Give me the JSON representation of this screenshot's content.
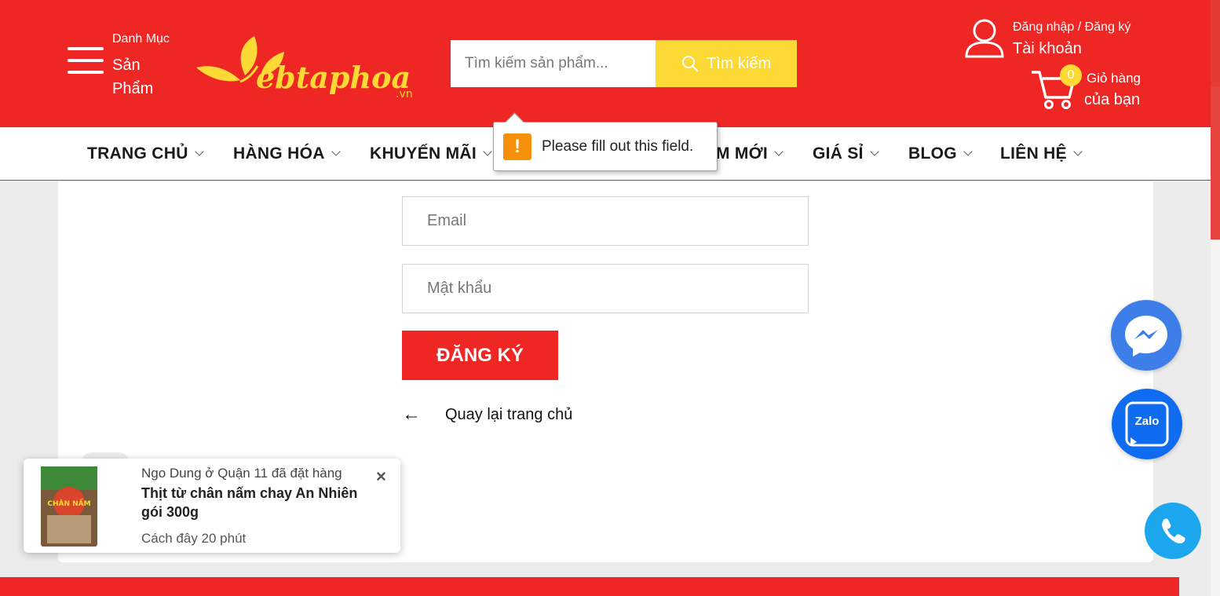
{
  "header": {
    "category_small": "Danh Mục",
    "category_line1": "Sản",
    "category_line2": "Phẩm",
    "logo_text": "ebtaphoa",
    "logo_suffix": ".vn",
    "search_placeholder": "Tìm kiếm sản phẩm...",
    "search_button": "Tìm kiếm",
    "account_line1": "Đăng nhập / Đăng ký",
    "account_line2": "Tài khoản",
    "cart_count": "0",
    "cart_line1": "Giỏ hàng",
    "cart_line2": "của bạn",
    "brand_color": "#ee2624",
    "accent_color": "#fcd935"
  },
  "nav": {
    "items": [
      {
        "label": "TRANG CHỦ"
      },
      {
        "label": "HÀNG HÓA"
      },
      {
        "label": "KHUYẾN MÃI"
      },
      {
        "label": "M MỚI"
      },
      {
        "label": "GIÁ SỈ"
      },
      {
        "label": "BLOG"
      },
      {
        "label": "LIÊN HỆ"
      }
    ]
  },
  "validation_tooltip": {
    "icon": "!",
    "message": "Please fill out this field."
  },
  "form": {
    "email_placeholder": "Email",
    "password_placeholder": "Mật khẩu",
    "submit_label": "ĐĂNG KÝ",
    "back_arrow": "←",
    "back_label": "Quay lại trang chủ"
  },
  "toast": {
    "line1": "Ngo Dung ở Quận 11 đã đặt hàng",
    "product": "Thịt từ chân nấm chay An Nhiên gói 300g",
    "time": "Cách đây 20 phút",
    "close": "×",
    "product_image_text": "CHÂN NẤM"
  },
  "floating": {
    "zalo_label": "Zalo"
  }
}
